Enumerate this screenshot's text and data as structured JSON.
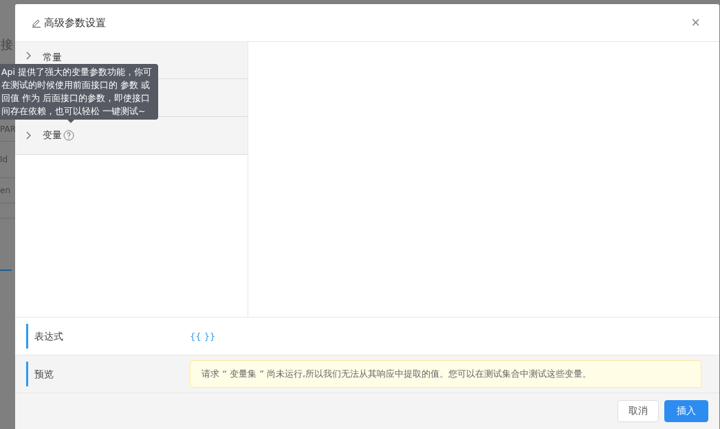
{
  "background_page": {
    "texts": [
      "接",
      "PAR",
      "Id",
      "en"
    ]
  },
  "dialog": {
    "title": "高级参数设置",
    "close": "×"
  },
  "collapse_items": [
    {
      "label": "常量",
      "expanded": false,
      "help": false
    },
    {
      "help": false
    },
    {
      "label": "变量",
      "expanded": false,
      "help": true
    }
  ],
  "tooltip": {
    "lines": [
      "Api 提供了强大的变量参数功能，你可",
      "在测试的时候使用前面接口的 参数 或",
      "回值 作为 后面接口的参数，即使接口",
      "间存在依赖，也可以轻松 一键测试~"
    ]
  },
  "expression": {
    "label": "表达式",
    "value": "{{ }}"
  },
  "preview": {
    "label": "预览",
    "message": "请求 “ 变量集 ” 尚未运行,所以我们无法从其响应中提取的值。您可以在测试集合中测试这些变量。"
  },
  "buttons": [
    {
      "label": "取消",
      "kind": "default"
    },
    {
      "label": "插入",
      "kind": "primary"
    }
  ]
}
